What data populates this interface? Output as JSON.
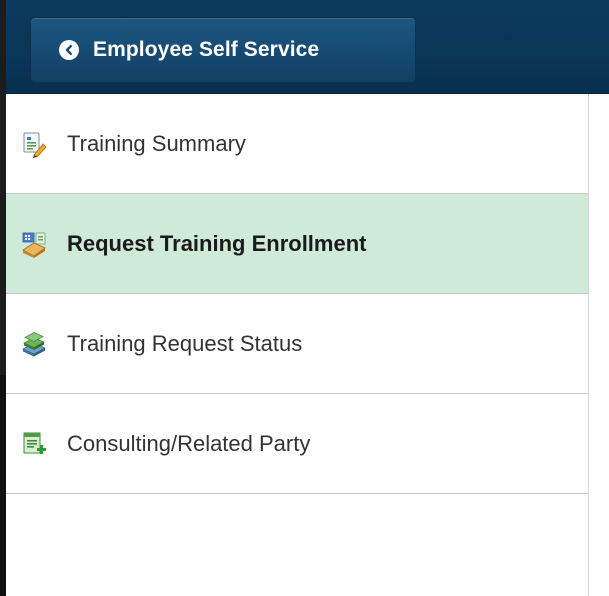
{
  "header": {
    "back_label": "Employee Self Service"
  },
  "menu": {
    "items": [
      {
        "label": "Training Summary",
        "icon": "document-edit-icon",
        "selected": false
      },
      {
        "label": "Request Training Enrollment",
        "icon": "enrollment-form-icon",
        "selected": true
      },
      {
        "label": "Training Request Status",
        "icon": "book-stack-icon",
        "selected": false
      },
      {
        "label": "Consulting/Related Party",
        "icon": "form-add-icon",
        "selected": false
      }
    ]
  },
  "colors": {
    "header_bg": "#0b3a5c",
    "button_bg": "#164a72",
    "selected_bg": "#cfead9",
    "divider": "#c8c8c8"
  }
}
